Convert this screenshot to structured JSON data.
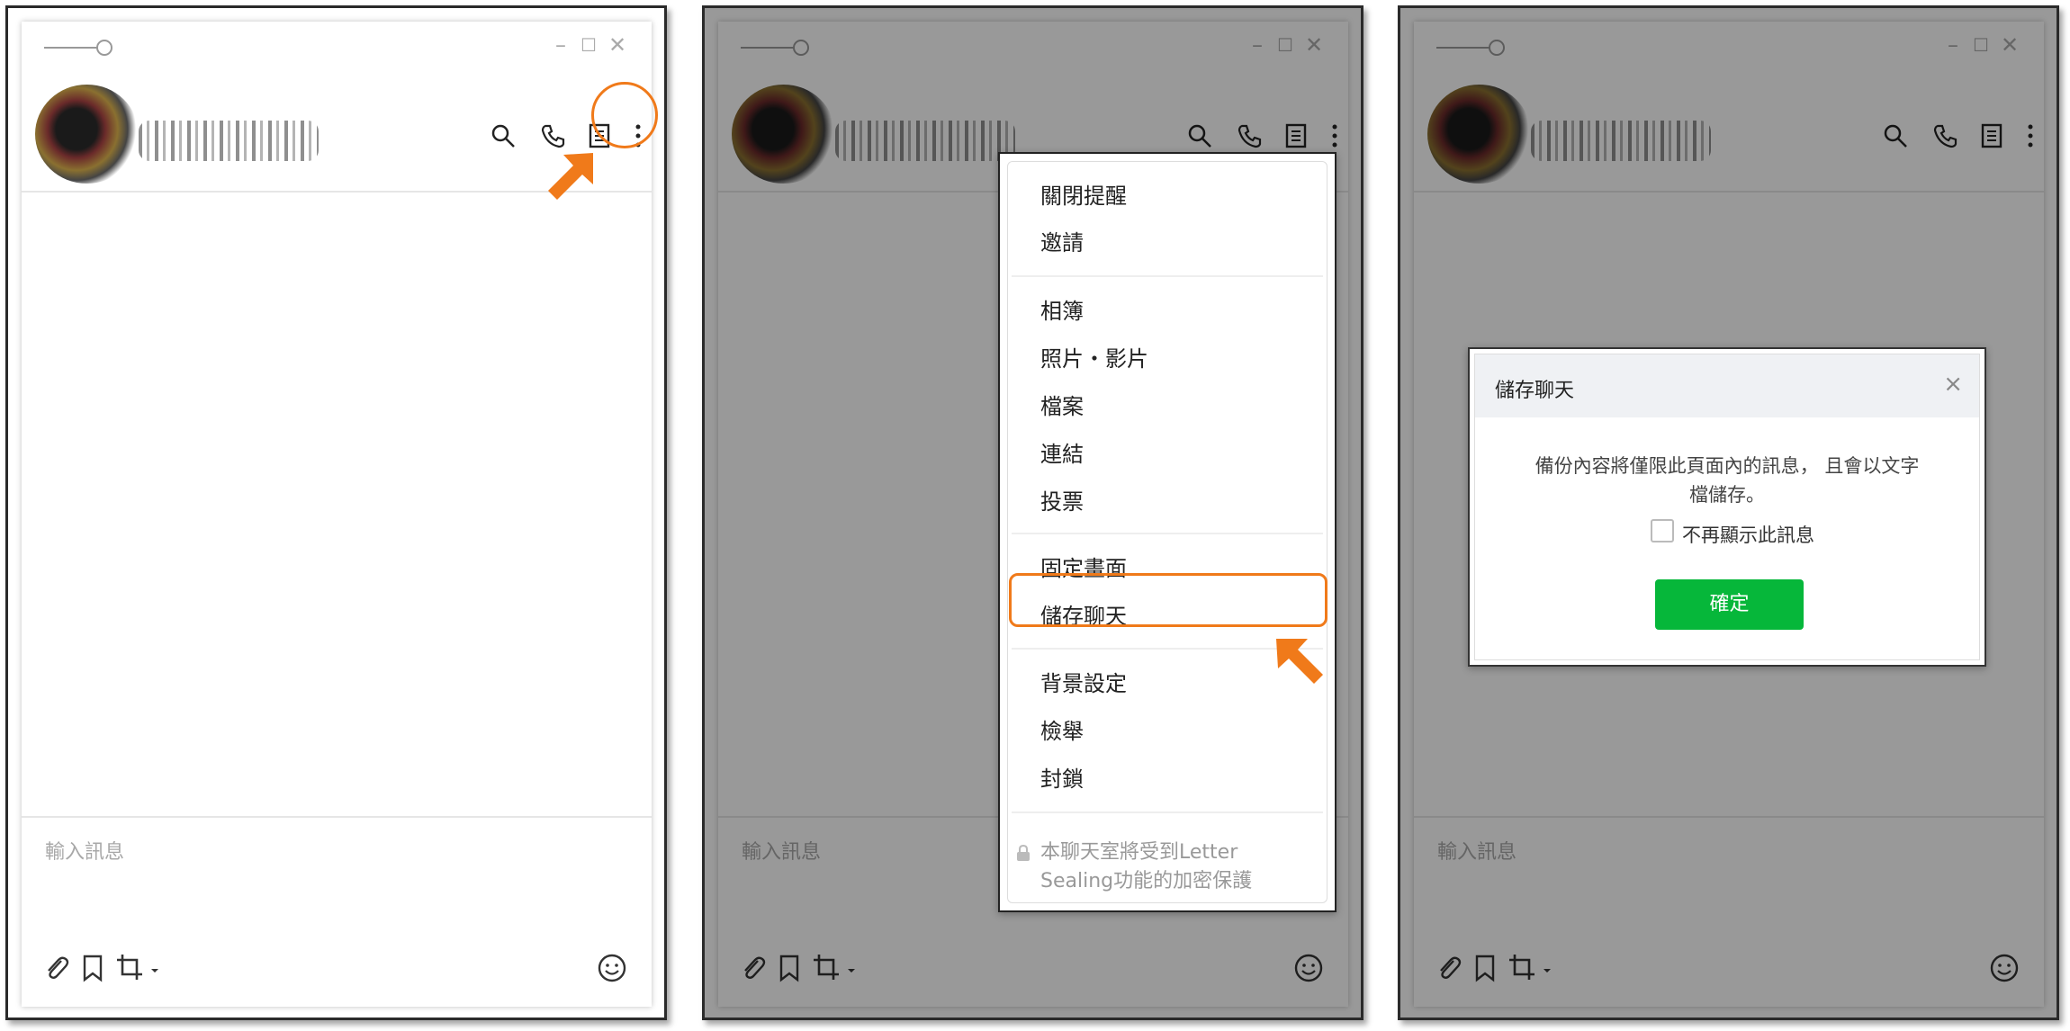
{
  "chat": {
    "input_placeholder": "輸入訊息",
    "window_controls": {
      "minimize": "–",
      "maximize": "☐",
      "close": "✕"
    },
    "header_icons": [
      "search-icon",
      "phone-icon",
      "notes-icon",
      "more-icon"
    ],
    "footer_icons": [
      "paperclip-icon",
      "bookmark-icon",
      "crop-icon",
      "emoji-icon"
    ]
  },
  "menu": {
    "group1": [
      "關閉提醒",
      "邀請"
    ],
    "group2": [
      "相簿",
      "照片・影片",
      "檔案",
      "連結",
      "投票"
    ],
    "group3": [
      "固定畫面",
      "儲存聊天"
    ],
    "group4": [
      "背景設定",
      "檢舉",
      "封鎖"
    ],
    "footer_line1": "本聊天室將受到Letter",
    "footer_line2": "Sealing功能的加密保護"
  },
  "dialog": {
    "title": "儲存聊天",
    "close": "×",
    "message_line1": "備份內容將僅限此頁面內的訊息， 且會以文字",
    "message_line2": "檔儲存。",
    "checkbox_label": "不再顯示此訊息",
    "confirm_label": "確定"
  },
  "colors": {
    "highlight": "#f07a1a",
    "confirm": "#06b73a",
    "overlay": "rgba(0,0,0,0.4)"
  }
}
